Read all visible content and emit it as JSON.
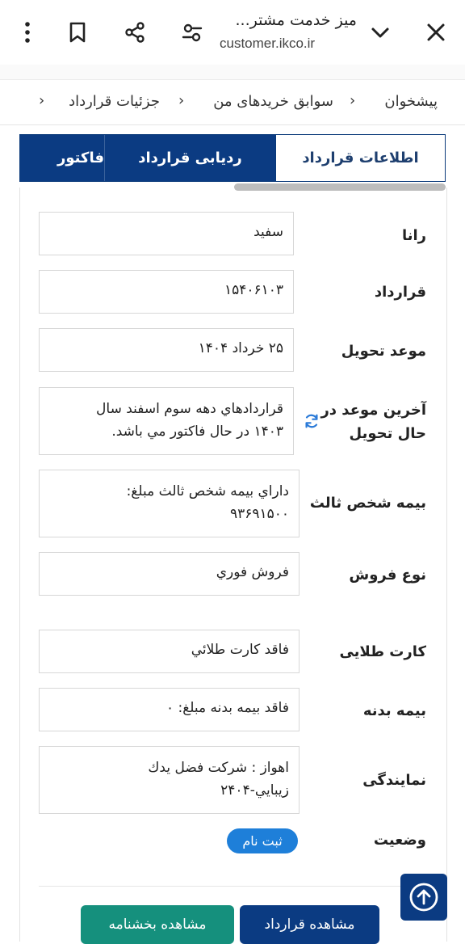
{
  "browser": {
    "title": "میز خدمت مشتر...",
    "url": "customer.ikco.ir",
    "icons": [
      "close-icon",
      "chevron-down-icon",
      "tune-icon",
      "share-icon",
      "bookmark-icon",
      "more-vertical-icon"
    ]
  },
  "breadcrumb": {
    "items": [
      "پیشخوان",
      "سوابق خریدهای من",
      "جزئیات قرارداد"
    ]
  },
  "tabs": [
    {
      "label": "اطلاعات قرارداد",
      "active": true
    },
    {
      "label": "ردیابی قرارداد",
      "active": false
    },
    {
      "label": "فاکتور",
      "active": false
    }
  ],
  "fields": [
    {
      "label": "رانا",
      "value": "سفید"
    },
    {
      "label": "قرارداد",
      "value": "۱۵۴۰۶۱۰۳"
    },
    {
      "label": "موعد تحویل",
      "value": "۲۵ خرداد ۱۴۰۴"
    },
    {
      "label_line1": "آخرین موعد در",
      "label_line2": "حال تحویل",
      "value_line1": "قراردادهاي دهه سوم اسفند سال",
      "value_line2": "۱۴۰۳ در حال فاكتور مي باشد."
    },
    {
      "label": "بیمه شخص ثالث",
      "value_line1": "داراي بيمه شخص ثالث مبلغ:",
      "value_line2": "۹۳۶۹۱۵۰۰"
    },
    {
      "label": "نوع فروش",
      "value": "فروش فوري"
    },
    {
      "label": "کارت طلایی",
      "value": "فاقد كارت طلائي"
    },
    {
      "label": "بیمه بدنه",
      "value": "فاقد بيمه بدنه مبلغ: ۰"
    },
    {
      "label": "نمایندگی",
      "value_line1": "اهواز : شركت فضل يدك",
      "value_line2": "زيبايي-۲۴۰۴"
    }
  ],
  "status": {
    "label": "وضعیت",
    "badge": "ثبت نام",
    "badge_color": "#1e7fd9"
  },
  "buttons": {
    "view_contract": "مشاهده قرارداد",
    "view_circular": "مشاهده بخشنامه"
  },
  "colors": {
    "primary": "#0b3b82",
    "green": "#15907d"
  }
}
